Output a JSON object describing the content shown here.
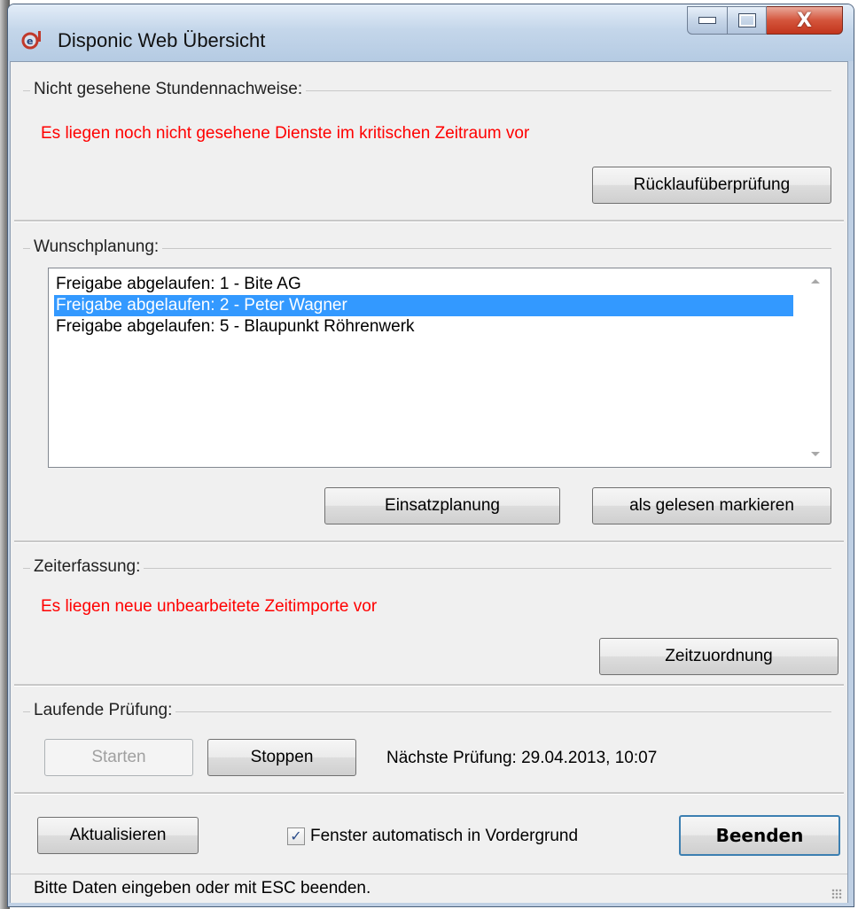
{
  "window": {
    "title": "Disponic Web Übersicht",
    "close_glyph": "X"
  },
  "section_stunden": {
    "label": "Nicht gesehene Stundennachweise:",
    "warning": "Es liegen noch nicht gesehene Dienste im kritischen Zeitraum vor",
    "button_label": "Rücklaufüberprüfung"
  },
  "section_wunsch": {
    "label": "Wunschplanung:",
    "items": [
      {
        "label": "Freigabe abgelaufen: 1 - Bite AG",
        "selected": false
      },
      {
        "label": "Freigabe abgelaufen: 2 - Peter Wagner",
        "selected": true
      },
      {
        "label": "Freigabe abgelaufen: 5 - Blaupunkt Röhrenwerk",
        "selected": false
      }
    ],
    "button_einsatz": "Einsatzplanung",
    "button_gelesen": "als gelesen markieren"
  },
  "section_zeit": {
    "label": "Zeiterfassung:",
    "warning": "Es liegen neue unbearbeitete Zeitimporte vor",
    "button_label": "Zeitzuordnung"
  },
  "section_pruefung": {
    "label": "Laufende Prüfung:",
    "button_start": "Starten",
    "button_stop": "Stoppen",
    "next_check": "Nächste Prüfung: 29.04.2013, 10:07"
  },
  "footer": {
    "refresh_label": "Aktualisieren",
    "checkbox_label": "Fenster automatisch in Vordergrund",
    "checkbox_checked": true,
    "quit_label": "Beenden"
  },
  "status": {
    "text": "Bitte Daten eingeben oder mit ESC beenden."
  },
  "colors": {
    "warning": "#ff0000",
    "selection": "#3399ff"
  }
}
